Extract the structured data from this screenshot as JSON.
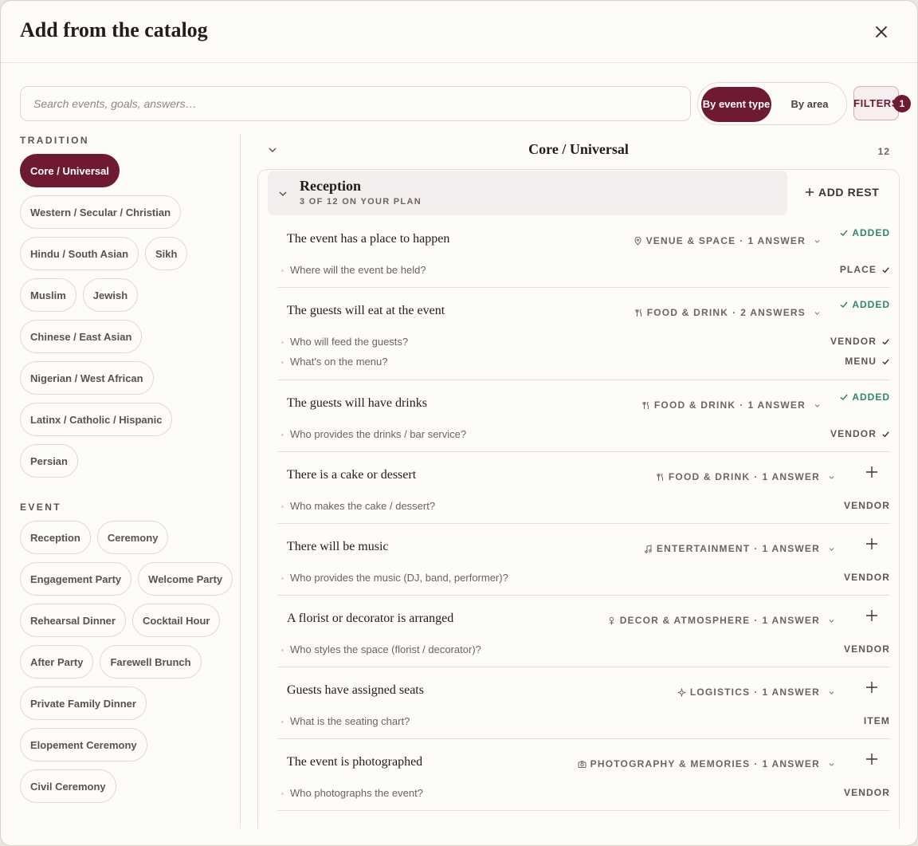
{
  "dialog": {
    "title": "Add from the catalog",
    "search_placeholder": "Search events, goals, answers…",
    "toggle_by_event_type": "By event type",
    "toggle_by_area": "By area",
    "filters_label": "FILTERS",
    "filters_count": "1"
  },
  "sidebar": {
    "tradition_label": "TRADITION",
    "traditions": [
      "Core / Universal",
      "Western / Secular / Christian",
      "Hindu / South Asian",
      "Sikh",
      "Muslim",
      "Jewish",
      "Chinese / East Asian",
      "Nigerian / West African",
      "Latinx / Catholic / Hispanic",
      "Persian"
    ],
    "event_label": "EVENT",
    "events": [
      "Reception",
      "Ceremony",
      "Engagement Party",
      "Welcome Party",
      "Rehearsal Dinner",
      "Cocktail Hour",
      "After Party",
      "Farewell Brunch",
      "Private Family Dinner",
      "Elopement Ceremony",
      "Civil Ceremony"
    ]
  },
  "main": {
    "section_title": "Core / Universal",
    "section_count": "12",
    "group_title": "Reception",
    "group_subtitle": "3 OF 12 ON YOUR PLAN",
    "add_rest": "ADD REST",
    "added_label": "ADDED",
    "goals": [
      {
        "title": "The event has a place to happen",
        "area": "VENUE & SPACE",
        "answers_count": "1 ANSWER",
        "icon": "pin-icon",
        "added": true,
        "answers": [
          {
            "q": "Where will the event be held?",
            "a": "PLACE",
            "done": true
          }
        ]
      },
      {
        "title": "The guests will eat at the event",
        "area": "FOOD & DRINK",
        "answers_count": "2 ANSWERS",
        "icon": "fork-knife-icon",
        "added": true,
        "answers": [
          {
            "q": "Who will feed the guests?",
            "a": "VENDOR",
            "done": true
          },
          {
            "q": "What's on the menu?",
            "a": "MENU",
            "done": true
          }
        ]
      },
      {
        "title": "The guests will have drinks",
        "area": "FOOD & DRINK",
        "answers_count": "1 ANSWER",
        "icon": "fork-knife-icon",
        "added": true,
        "answers": [
          {
            "q": "Who provides the drinks / bar service?",
            "a": "VENDOR",
            "done": true
          }
        ]
      },
      {
        "title": "There is a cake or dessert",
        "area": "FOOD & DRINK",
        "answers_count": "1 ANSWER",
        "icon": "fork-knife-icon",
        "added": false,
        "answers": [
          {
            "q": "Who makes the cake / dessert?",
            "a": "VENDOR",
            "done": false
          }
        ]
      },
      {
        "title": "There will be music",
        "area": "ENTERTAINMENT",
        "answers_count": "1 ANSWER",
        "icon": "music-note-icon",
        "added": false,
        "answers": [
          {
            "q": "Who provides the music (DJ, band, performer)?",
            "a": "VENDOR",
            "done": false
          }
        ]
      },
      {
        "title": "A florist or decorator is arranged",
        "area": "DECOR & ATMOSPHERE",
        "answers_count": "1 ANSWER",
        "icon": "flower-icon",
        "added": false,
        "answers": [
          {
            "q": "Who styles the space (florist / decorator)?",
            "a": "VENDOR",
            "done": false
          }
        ]
      },
      {
        "title": "Guests have assigned seats",
        "area": "LOGISTICS",
        "answers_count": "1 ANSWER",
        "icon": "sparkle-icon",
        "added": false,
        "answers": [
          {
            "q": "What is the seating chart?",
            "a": "ITEM",
            "done": false
          }
        ]
      },
      {
        "title": "The event is photographed",
        "area": "PHOTOGRAPHY & MEMORIES",
        "answers_count": "1 ANSWER",
        "icon": "camera-icon",
        "added": false,
        "answers": [
          {
            "q": "Who photographs the event?",
            "a": "VENDOR",
            "done": false
          }
        ]
      }
    ]
  },
  "colors": {
    "accent": "#6e1a33",
    "added_green": "#2e8a60",
    "background": "#fdfcf8"
  }
}
